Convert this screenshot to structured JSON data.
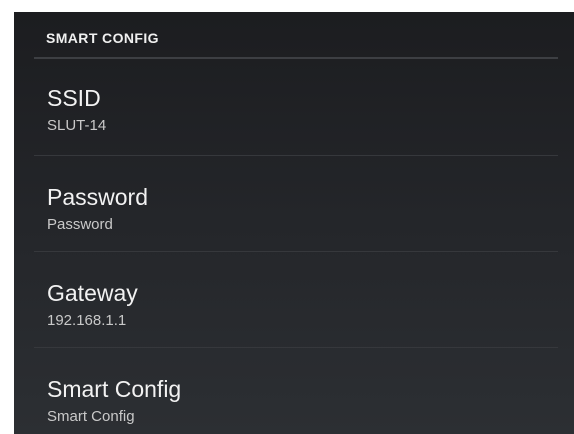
{
  "section": {
    "title": "SMART CONFIG"
  },
  "items": [
    {
      "title": "SSID",
      "summary": "SLUT-14"
    },
    {
      "title": "Password",
      "summary": "Password"
    },
    {
      "title": "Gateway",
      "summary": "192.168.1.1"
    },
    {
      "title": "Smart Config",
      "summary": "Smart Config"
    }
  ],
  "colors": {
    "background": "#222427",
    "title_text": "#f2f2f2",
    "summary_text": "#c9c9c9",
    "divider": "#3d3f43"
  }
}
